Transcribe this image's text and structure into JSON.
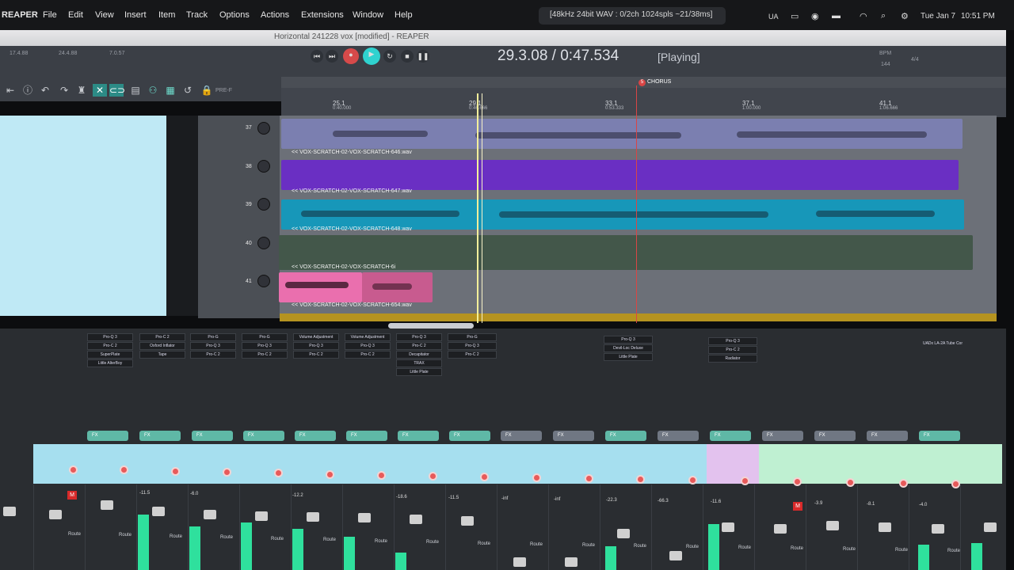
{
  "menubar": {
    "app": "REAPER",
    "items": [
      "File",
      "Edit",
      "View",
      "Insert",
      "Item",
      "Track",
      "Options",
      "Actions",
      "Extensions",
      "Window",
      "Help"
    ],
    "status": "[48kHz 24bit WAV : 0/2ch 1024spls ~21/38ms]",
    "sys": {
      "input": "UA",
      "date": "Tue Jan 7",
      "time": "10:51 PM"
    }
  },
  "window": {
    "title": "Horizontal 241228 vox [modified] - REAPER"
  },
  "toolbar": {
    "left_values": [
      "17.4.88",
      "24.4.88",
      "7.0.57"
    ],
    "time": "29.3.08 / 0:47.534",
    "state": "[Playing]",
    "bpm_label": "BPM",
    "bpm_value": "144",
    "pref": "PRE-F",
    "right_label": "4/4"
  },
  "ruler": {
    "marks": [
      {
        "bar": "25.1",
        "time": "0:40.000"
      },
      {
        "bar": "29.1",
        "time": "0:46.666"
      },
      {
        "bar": "33.1",
        "time": "0:53.333"
      },
      {
        "bar": "37.1",
        "time": "1:00.000"
      },
      {
        "bar": "41.1",
        "time": "1:06.666"
      }
    ],
    "marker": "CHORUS",
    "marker_id": "5"
  },
  "tracks": [
    {
      "num": "37",
      "label": "<< VOX-SCRATCH-02-VOX-SCRATCH-646.wav",
      "color": "#7b7fb0"
    },
    {
      "num": "38",
      "label": "<< VOX-SCRATCH-02-VOX-SCRATCH-647.wav",
      "color": "#6a2fc3"
    },
    {
      "num": "39",
      "label": "<< VOX-SCRATCH-02-VOX-SCRATCH-648.wav",
      "color": "#1797b9"
    },
    {
      "num": "40",
      "label": "<< VOX-SCRATCH-02-VOX-SCRATCH-6i",
      "color": "#43574a"
    },
    {
      "num": "41",
      "label": "<< VOX-SCRATCH-02-VOX-SCRATCH-654.wav",
      "color": "#ea6fae"
    }
  ],
  "mixer": {
    "fx_slots": [
      [
        "Pro-Q 3",
        "Pro-C 2",
        "SuperPlate",
        "Little AlterBoy"
      ],
      [
        "Pro-C 2",
        "Oxford Inflator",
        "Tape"
      ],
      [
        "Pro-G",
        "Pro-Q 3",
        "Pro-C 2"
      ],
      [
        "Pro-G",
        "Pro-Q 3",
        "Pro-C 2"
      ],
      [
        "Volume Adjustment",
        "Pro-Q 3",
        "Pro-C 2"
      ],
      [
        "Volume Adjustment",
        "Pro-Q 3",
        "Pro-C 2"
      ],
      [
        "Pro-Q 3",
        "Pro-C 2",
        "Decapitator",
        "TRAX",
        "Little Plate"
      ],
      [
        "Pro-G",
        "Pro-Q 3",
        "Pro-C 2"
      ],
      [
        "Pro-Q 3",
        "Devil-Loc Deluxe",
        "Little Plate"
      ],
      [
        "Pro-Q 3",
        "Pro-C 2",
        "Radiator"
      ],
      [
        "UADx LA-2A Tube Cor"
      ]
    ],
    "fx_label": "FX",
    "route_label": "Route",
    "db_values": [
      "-11.5",
      "-6.0",
      "-12.2",
      "-18.6",
      "-11.5",
      "-inf",
      "-inf",
      "-22.3",
      "-66.3",
      "-11.6",
      "-3.9",
      "-8.1",
      "-4.0"
    ]
  }
}
